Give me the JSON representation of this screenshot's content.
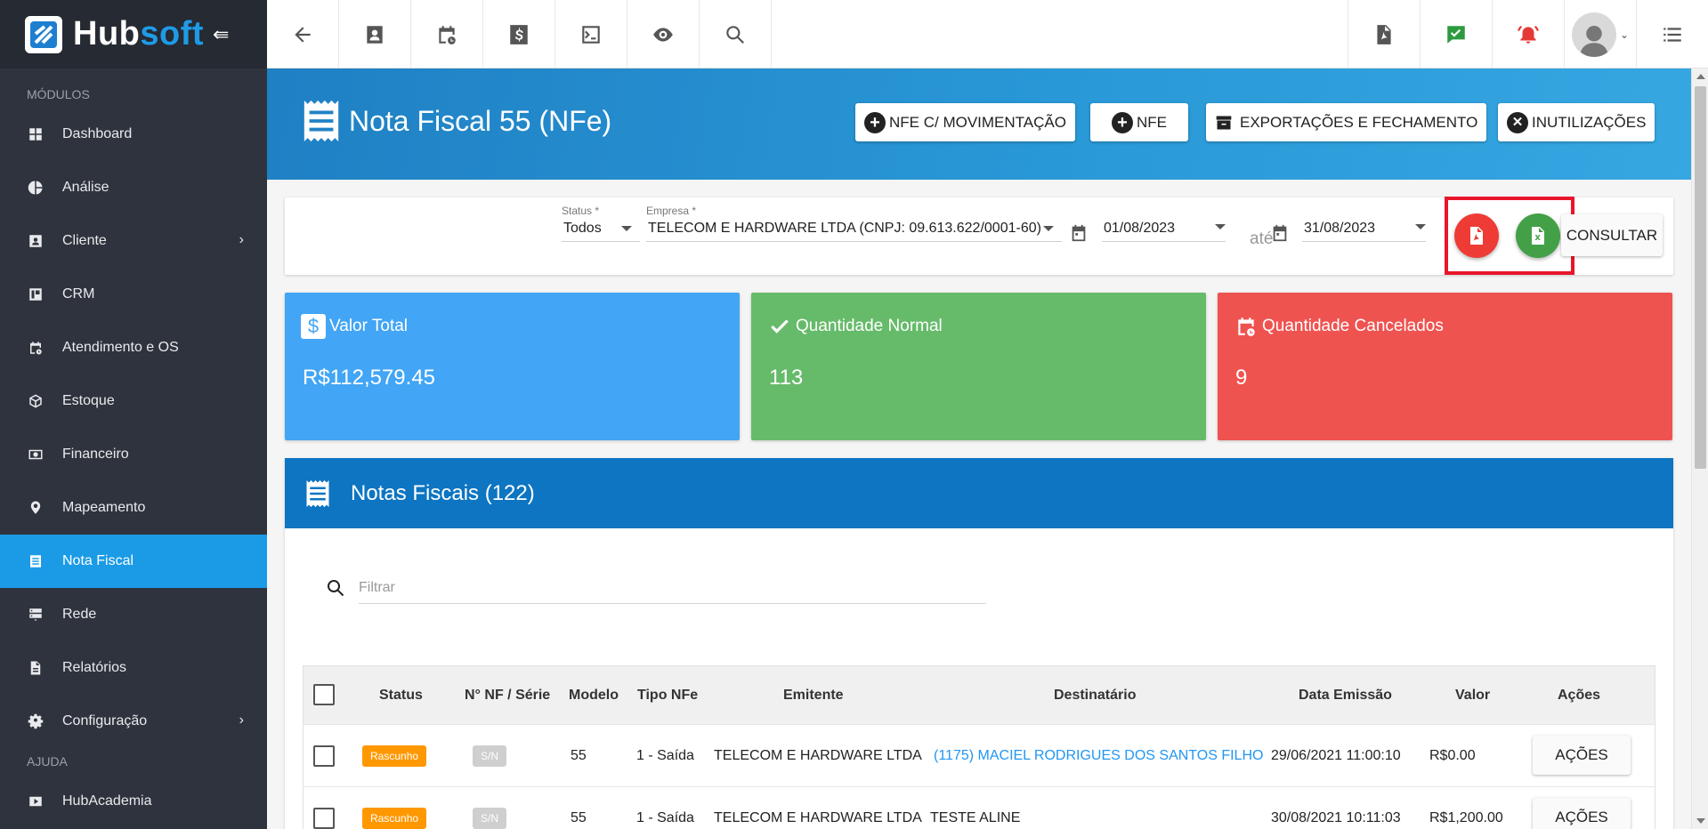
{
  "brand": {
    "name_a": "Hub",
    "name_b": "soft"
  },
  "sidebar": {
    "section_modules": "MÓDULOS",
    "section_help": "AJUDA",
    "items": [
      {
        "label": "Dashboard",
        "icon": "dashboard-icon"
      },
      {
        "label": "Análise",
        "icon": "pie-chart-icon"
      },
      {
        "label": "Cliente",
        "icon": "contact-card-icon",
        "has_children": true
      },
      {
        "label": "CRM",
        "icon": "board-icon"
      },
      {
        "label": "Atendimento e OS",
        "icon": "calendar-clock-icon"
      },
      {
        "label": "Estoque",
        "icon": "box-icon"
      },
      {
        "label": "Financeiro",
        "icon": "money-icon"
      },
      {
        "label": "Mapeamento",
        "icon": "map-pin-icon"
      },
      {
        "label": "Nota Fiscal",
        "icon": "receipt-icon",
        "active": true
      },
      {
        "label": "Rede",
        "icon": "server-icon"
      },
      {
        "label": "Relatórios",
        "icon": "file-icon"
      },
      {
        "label": "Configuração",
        "icon": "gear-icon",
        "has_children": true
      }
    ],
    "help_items": [
      {
        "label": "HubAcademia",
        "icon": "play-icon"
      }
    ]
  },
  "page": {
    "title": "Nota Fiscal 55 (NFe)",
    "buttons": {
      "nfe_mov": "NFE C/ MOVIMENTAÇÃO",
      "nfe": "NFE",
      "export": "EXPORTAÇÕES E FECHAMENTO",
      "inutil": "INUTILIZAÇÕES"
    }
  },
  "filters": {
    "status_label": "Status *",
    "status_value": "Todos",
    "empresa_label": "Empresa *",
    "empresa_value": "TELECOM E HARDWARE LTDA (CNPJ: 09.613.622/0001-60)",
    "date_from": "01/08/2023",
    "date_sep": "até",
    "date_to": "31/08/2023",
    "consultar": "CONSULTAR"
  },
  "stats": {
    "valor_total_label": "Valor Total",
    "valor_total": "R$112,579.45",
    "normal_label": "Quantidade Normal",
    "normal": "113",
    "cancel_label": "Quantidade Cancelados",
    "cancel": "9"
  },
  "table": {
    "title": "Notas Fiscais (122)",
    "filter_placeholder": "Filtrar",
    "columns": [
      "Status",
      "N° NF / Série",
      "Modelo",
      "Tipo NFe",
      "Emitente",
      "Destinatário",
      "Data Emissão",
      "Valor",
      "Ações"
    ],
    "rows": [
      {
        "status": "Rascunho",
        "nf": "S/N",
        "modelo": "55",
        "tipo": "1 - Saída",
        "emitente": "TELECOM E HARDWARE LTDA",
        "destinatario": "(1175) MACIEL RODRIGUES DOS SANTOS FILHO",
        "data": "29/06/2021 11:00:10",
        "valor": "R$0.00",
        "acao": "AÇÕES"
      },
      {
        "status": "Rascunho",
        "nf": "S/N",
        "modelo": "55",
        "tipo": "1 - Saída",
        "emitente": "TELECOM E HARDWARE LTDA",
        "destinatario": "TESTE ALINE",
        "data": "30/08/2021 10:11:03",
        "valor": "R$1,200.00",
        "acao": "AÇÕES"
      }
    ]
  },
  "colors": {
    "sidebar": "#2f333d",
    "active": "#1b9be6",
    "card_blue": "#42a5f5",
    "card_green": "#66bb6a",
    "card_red": "#ef5350",
    "panel_header": "#0d75c2",
    "highlight": "#e8162b"
  }
}
